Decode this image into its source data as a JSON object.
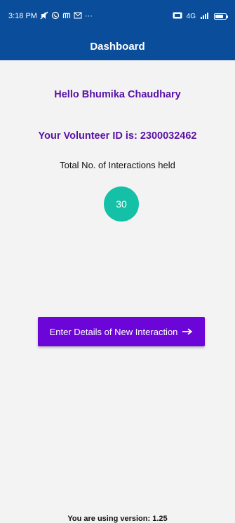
{
  "status_bar": {
    "time": "3:18 PM",
    "icons_left": [
      "mute-icon",
      "whatsapp-icon",
      "m-icon",
      "mail-icon",
      "more-icon"
    ],
    "more_text": "···",
    "network_text": "4G",
    "icons_right": [
      "hd-icon",
      "signal-icon",
      "battery-icon"
    ]
  },
  "app_bar": {
    "title": "Dashboard"
  },
  "main": {
    "greeting": "Hello Bhumika Chaudhary",
    "volunteer_id": "Your Volunteer ID is: 2300032462",
    "total_label": "Total No. of Interactions held",
    "total_count": "30",
    "button_label": "Enter Details of New Interaction",
    "button_icon": "arrow-right-icon"
  },
  "footer": {
    "version_text": "You are using version: 1.25"
  },
  "colors": {
    "primary_blue": "#0a4d9a",
    "purple_text": "#5a12a6",
    "button_purple": "#6c05d8",
    "teal": "#15c1a6",
    "background": "#f3f3f3"
  }
}
